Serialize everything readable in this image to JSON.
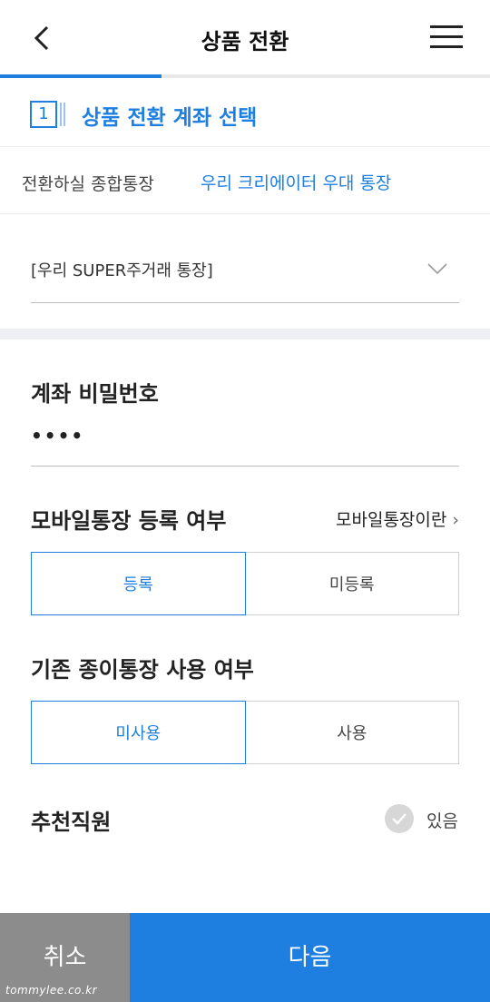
{
  "header": {
    "title": "상품 전환"
  },
  "step": {
    "number": "1",
    "label": "상품 전환 계좌 선택"
  },
  "convert": {
    "label": "전환하실 종합통장",
    "value": "우리 크리에이터 우대 통장"
  },
  "account_select": {
    "value": "[우리 SUPER주거래 통장]"
  },
  "password": {
    "label": "계좌 비밀번호",
    "value": "••••"
  },
  "mobile_passbook": {
    "label": "모바일통장 등록 여부",
    "link": "모바일통장이란",
    "options": [
      "등록",
      "미등록"
    ],
    "selected": "등록"
  },
  "paper_passbook": {
    "label": "기존 종이통장 사용 여부",
    "options": [
      "미사용",
      "사용"
    ],
    "selected": "미사용"
  },
  "recommender": {
    "label": "추천직원",
    "checkbox_label": "있음",
    "checked": false
  },
  "footer": {
    "cancel": "취소",
    "next": "다음"
  },
  "watermark": "tommylee.co.kr",
  "colors": {
    "accent": "#1e7fe0",
    "cancel_bg": "#8c8c8c"
  }
}
